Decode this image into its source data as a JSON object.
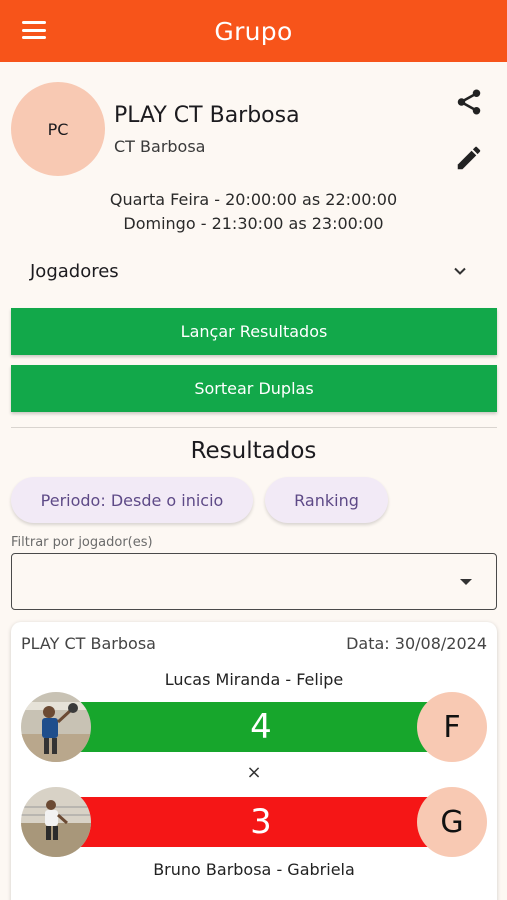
{
  "appbar": {
    "title": "Grupo"
  },
  "group": {
    "initials": "PC",
    "name": "PLAY CT Barbosa",
    "location": "CT Barbosa",
    "schedule": [
      "Quarta Feira - 20:00:00 as 22:00:00",
      "Domingo - 21:30:00 as 23:00:00"
    ]
  },
  "players": {
    "label": "Jogadores"
  },
  "actions": {
    "launch_results": "Lançar Resultados",
    "draw_pairs": "Sortear Duplas"
  },
  "results": {
    "title": "Resultados",
    "period_chip": "Periodo: Desde o inicio",
    "ranking_chip": "Ranking",
    "filter_label": "Filtrar por jogador(es)",
    "filter_value": ""
  },
  "match": {
    "group": "PLAY CT Barbosa",
    "date": "Data: 30/08/2024",
    "team_a": {
      "players": "Lucas  Miranda - Felipe",
      "score": "4",
      "initial": "F",
      "color": "#17a62c"
    },
    "vs": "×",
    "team_b": {
      "players": "Bruno Barbosa - Gabriela",
      "score": "3",
      "initial": "G",
      "color": "#f51616"
    }
  },
  "colors": {
    "primary": "#f7541a",
    "button": "#12a84a",
    "chip_bg": "#f2eaf6",
    "chip_text": "#5e4a87",
    "avatar_bg": "#f8c9b3"
  },
  "icons": [
    "menu-icon",
    "share-icon",
    "edit-icon",
    "chevron-down-icon",
    "dropdown-caret-icon"
  ]
}
